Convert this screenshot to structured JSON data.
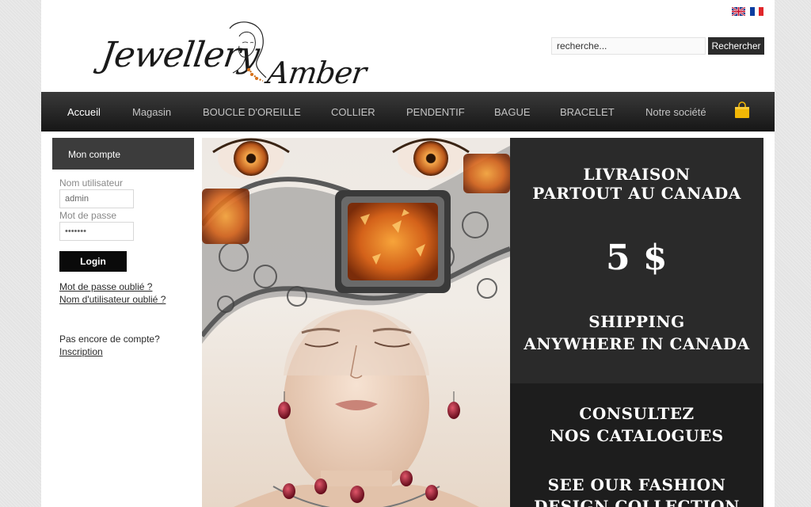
{
  "header": {
    "languages": [
      {
        "name": "English",
        "icon": "uk-flag-icon"
      },
      {
        "name": "Français",
        "icon": "france-flag-icon"
      }
    ],
    "logo_line1": "Jewellery",
    "logo_line2": "Amber",
    "search_placeholder": "recherche...",
    "search_button": "Rechercher"
  },
  "nav": {
    "items": [
      {
        "label": "Accueil",
        "active": true
      },
      {
        "label": "Magasin"
      },
      {
        "label": "BOUCLE D'OREILLE"
      },
      {
        "label": "COLLIER"
      },
      {
        "label": "PENDENTIF"
      },
      {
        "label": "BAGUE"
      },
      {
        "label": "BRACELET"
      },
      {
        "label": "Notre société"
      }
    ],
    "cart_icon": "shopping-bag-icon"
  },
  "sidebar": {
    "title": "Mon compte",
    "username_label": "Nom utilisateur",
    "username_value": "admin",
    "password_label": "Mot de passe",
    "password_value": "•••••••",
    "login_button": "Login",
    "forgot_password": "Mot de passe oublié ?",
    "forgot_username": "Nom d'utilisateur oublié ?",
    "no_account": "Pas encore de compte?",
    "register": "Inscription"
  },
  "promo": {
    "line1": "LIVRAISON",
    "line2": "PARTOUT AU CANADA",
    "price": "5 $",
    "line3": "SHIPPING",
    "line4": "ANYWHERE IN CANADA",
    "line5": "CONSULTEZ",
    "line6": "NOS CATALOGUES",
    "line7": "SEE OUR FASHION",
    "line8": "DESIGN COLLECTION"
  },
  "colors": {
    "nav_bg": "#1f1f1f",
    "amber": "#d9721a",
    "cart": "#f2b705"
  }
}
